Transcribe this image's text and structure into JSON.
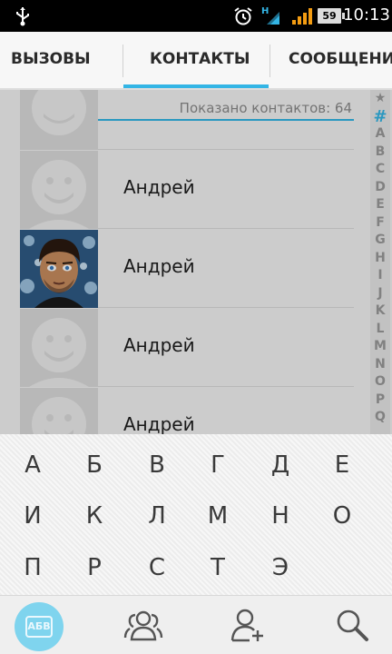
{
  "status_bar": {
    "network_label": "H",
    "battery_level": "59",
    "time": "10:13"
  },
  "tabs": [
    {
      "label": "ВЫЗОВЫ",
      "active": false
    },
    {
      "label": "КОНТАКТЫ",
      "active": true
    },
    {
      "label": "СООБЩЕНИЯ",
      "active": false
    }
  ],
  "contacts": {
    "section_letter": "A",
    "shown_count_text": "Показано контактов: 64",
    "rows": [
      {
        "name": "",
        "avatar": "default"
      },
      {
        "name": "Андрей",
        "avatar": "default"
      },
      {
        "name": "Андрей",
        "avatar": "photo"
      },
      {
        "name": "Андрей",
        "avatar": "default"
      },
      {
        "name": "Андрей",
        "avatar": "default"
      }
    ]
  },
  "alphabet_index": [
    "★",
    "#",
    "A",
    "B",
    "C",
    "D",
    "E",
    "F",
    "G",
    "H",
    "I",
    "J",
    "K",
    "L",
    "M",
    "N",
    "O",
    "P",
    "Q"
  ],
  "keyboard": {
    "rows": [
      [
        "А",
        "Б",
        "В",
        "Г",
        "Д",
        "Е"
      ],
      [
        "И",
        "К",
        "Л",
        "М",
        "Н",
        "О"
      ],
      [
        "П",
        "Р",
        "С",
        "Т",
        "Э"
      ]
    ]
  },
  "bottom_bar": {
    "abc_label": "АБВ",
    "icons": [
      "alphabet-keyboard-icon",
      "groups-icon",
      "add-contact-icon",
      "search-icon"
    ]
  },
  "colors": {
    "accent": "#33b5e5",
    "abc_button": "#7fd4ee"
  }
}
